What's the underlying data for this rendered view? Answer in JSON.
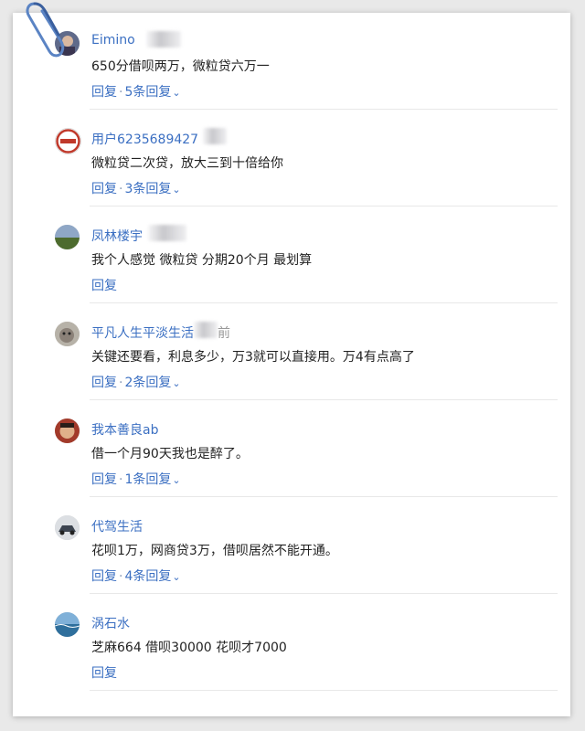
{
  "comments": [
    {
      "name": "Eimino",
      "text": "650分借呗两万，微粒贷六万一",
      "reply": "回复",
      "replies": "5条回复",
      "avatar": "avatar-photo-icon"
    },
    {
      "name": "用户6235689427",
      "text": "微粒贷二次贷，放大三到十倍给你",
      "reply": "回复",
      "replies": "3条回复",
      "avatar": "avatar-badge-icon"
    },
    {
      "name": "凤林楼宇",
      "text": "我个人感觉 微粒贷 分期20个月 最划算",
      "reply": "回复",
      "replies": "",
      "avatar": "avatar-landscape-icon"
    },
    {
      "name": "平凡人生平淡生活",
      "name_suffix": "前",
      "text": "关键还要看，利息多少，万3就可以直接用。万4有点高了",
      "reply": "回复",
      "replies": "2条回复",
      "avatar": "avatar-animal-icon"
    },
    {
      "name": "我本善良ab",
      "text": "借一个月90天我也是醉了。",
      "reply": "回复",
      "replies": "1条回复",
      "avatar": "avatar-face-icon"
    },
    {
      "name": "代驾生活",
      "text": "花呗1万，网商贷3万，借呗居然不能开通。",
      "reply": "回复",
      "replies": "4条回复",
      "avatar": "avatar-car-icon"
    },
    {
      "name": "涡石水",
      "text": "芝麻664 借呗30000 花呗才7000",
      "reply": "回复",
      "replies": "",
      "avatar": "avatar-sea-icon"
    }
  ],
  "colors": {
    "link": "#3b6fc2",
    "text": "#222222",
    "divider": "#e8e8e8"
  }
}
